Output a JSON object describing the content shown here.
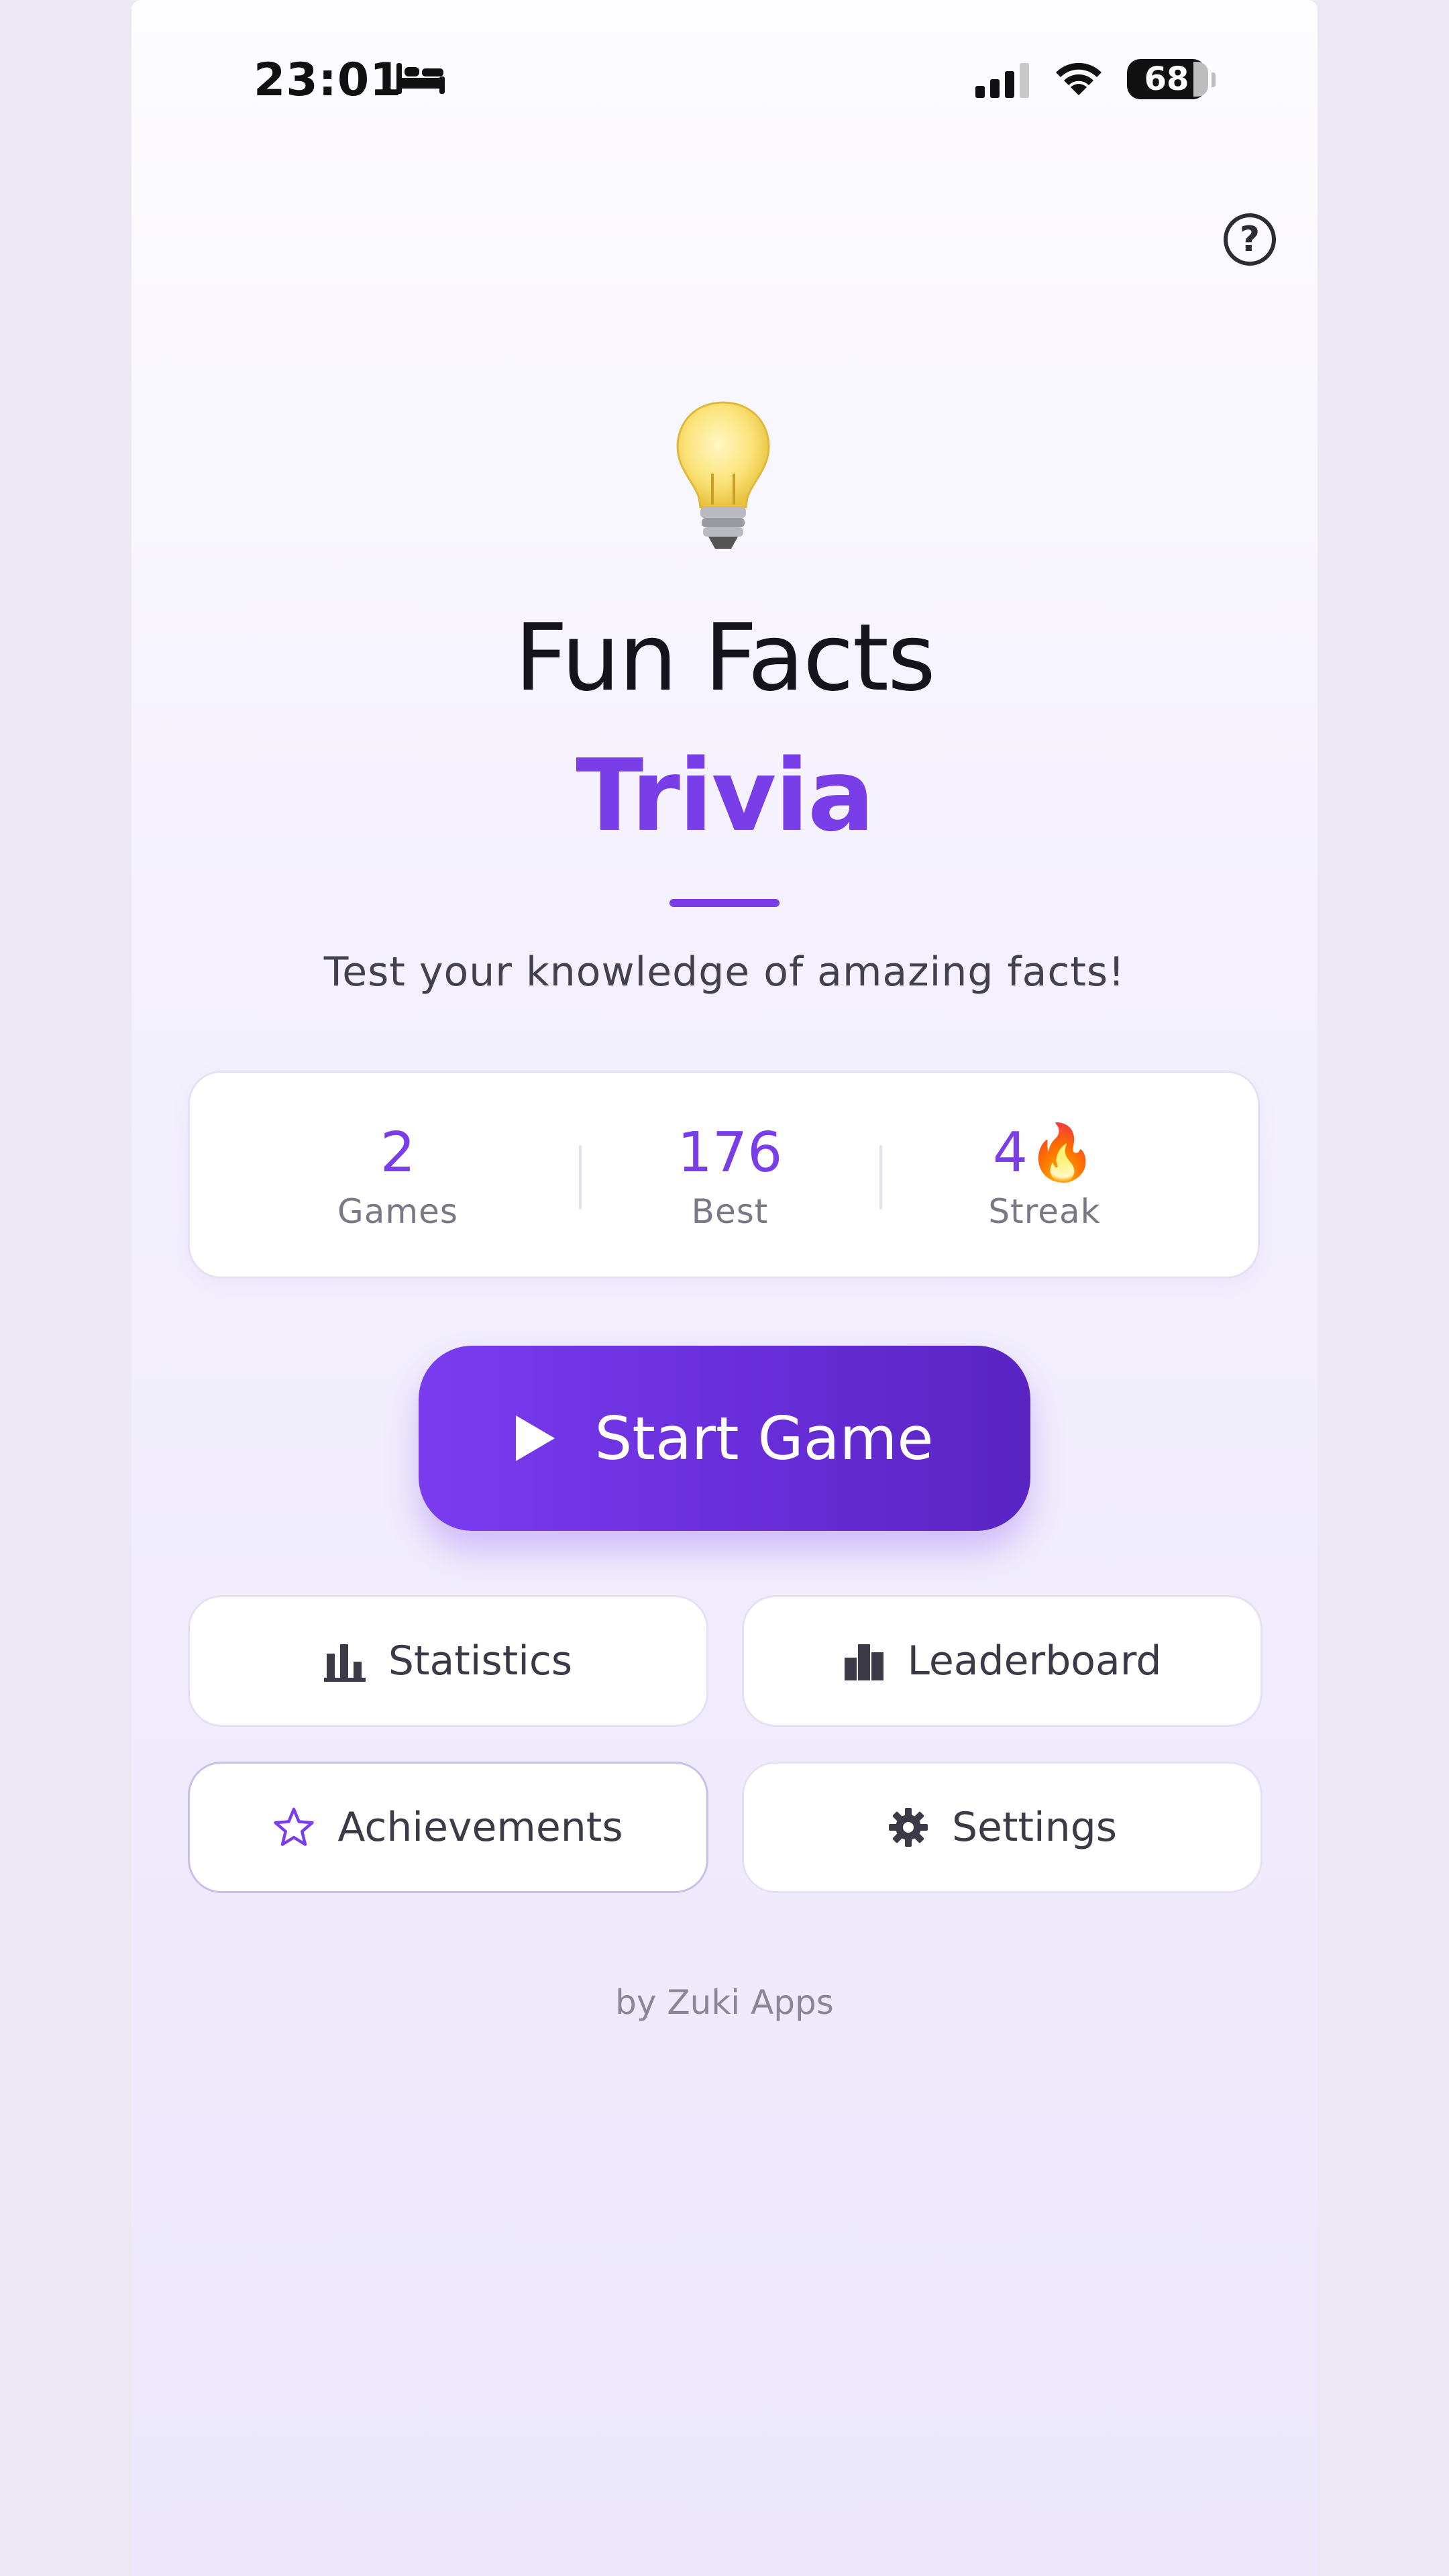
{
  "status_bar": {
    "time": "23:01",
    "battery": "68"
  },
  "help": {
    "label": "?"
  },
  "header": {
    "title": "Fun Facts",
    "subtitle": "Trivia",
    "tagline": "Test your knowledge of amazing facts!"
  },
  "stats": [
    {
      "value": "2",
      "label": "Games"
    },
    {
      "value": "176",
      "label": "Best"
    },
    {
      "value": "4🔥",
      "label": "Streak"
    }
  ],
  "start_button": {
    "label": "Start Game"
  },
  "menu": {
    "statistics": "Statistics",
    "leaderboard": "Leaderboard",
    "achievements": "Achievements",
    "settings": "Settings"
  },
  "footer": "by Zuki Apps",
  "colors": {
    "accent": "#7a3ee8",
    "title": "#15131c"
  }
}
